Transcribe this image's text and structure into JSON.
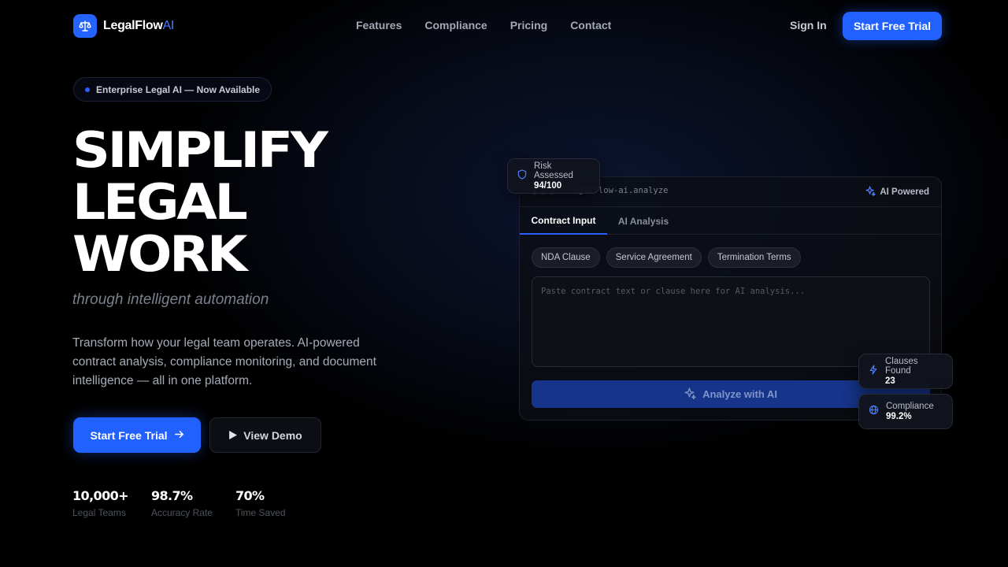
{
  "brand": {
    "name": "LegalFlow",
    "suffix": "AI",
    "accent": "#2563ff"
  },
  "nav": {
    "links": [
      "Features",
      "Compliance",
      "Pricing",
      "Contact"
    ],
    "sign_in": "Sign In",
    "cta": "Start Free Trial"
  },
  "hero": {
    "badge": "Enterprise Legal AI — Now Available",
    "headline": [
      "SIMPLIFY",
      "LEGAL",
      "WORK"
    ],
    "tagline": "through intelligent automation",
    "description": "Transform how your legal team operates. AI-powered contract analysis, compliance monitoring, and document intelligence — all in one platform.",
    "primary_cta": "Start Free Trial",
    "secondary_cta": "View Demo",
    "stats": [
      {
        "value": "10,000+",
        "label": "Legal Teams"
      },
      {
        "value": "98.7%",
        "label": "Accuracy Rate"
      },
      {
        "value": "70%",
        "label": "Time Saved"
      }
    ]
  },
  "panel": {
    "url": "legalflow-ai.analyze",
    "ai_badge": "AI Powered",
    "tabs": [
      "Contract Input",
      "AI Analysis"
    ],
    "chips": [
      "NDA Clause",
      "Service Agreement",
      "Termination Terms"
    ],
    "placeholder": "Paste contract text or clause here for AI analysis...",
    "analyze_label": "Analyze with AI"
  },
  "floating": {
    "risk": {
      "label": "Risk Assessed",
      "value": "94/100"
    },
    "clauses": {
      "label": "Clauses Found",
      "value": "23"
    },
    "compliance": {
      "label": "Compliance",
      "value": "99.2%"
    }
  }
}
